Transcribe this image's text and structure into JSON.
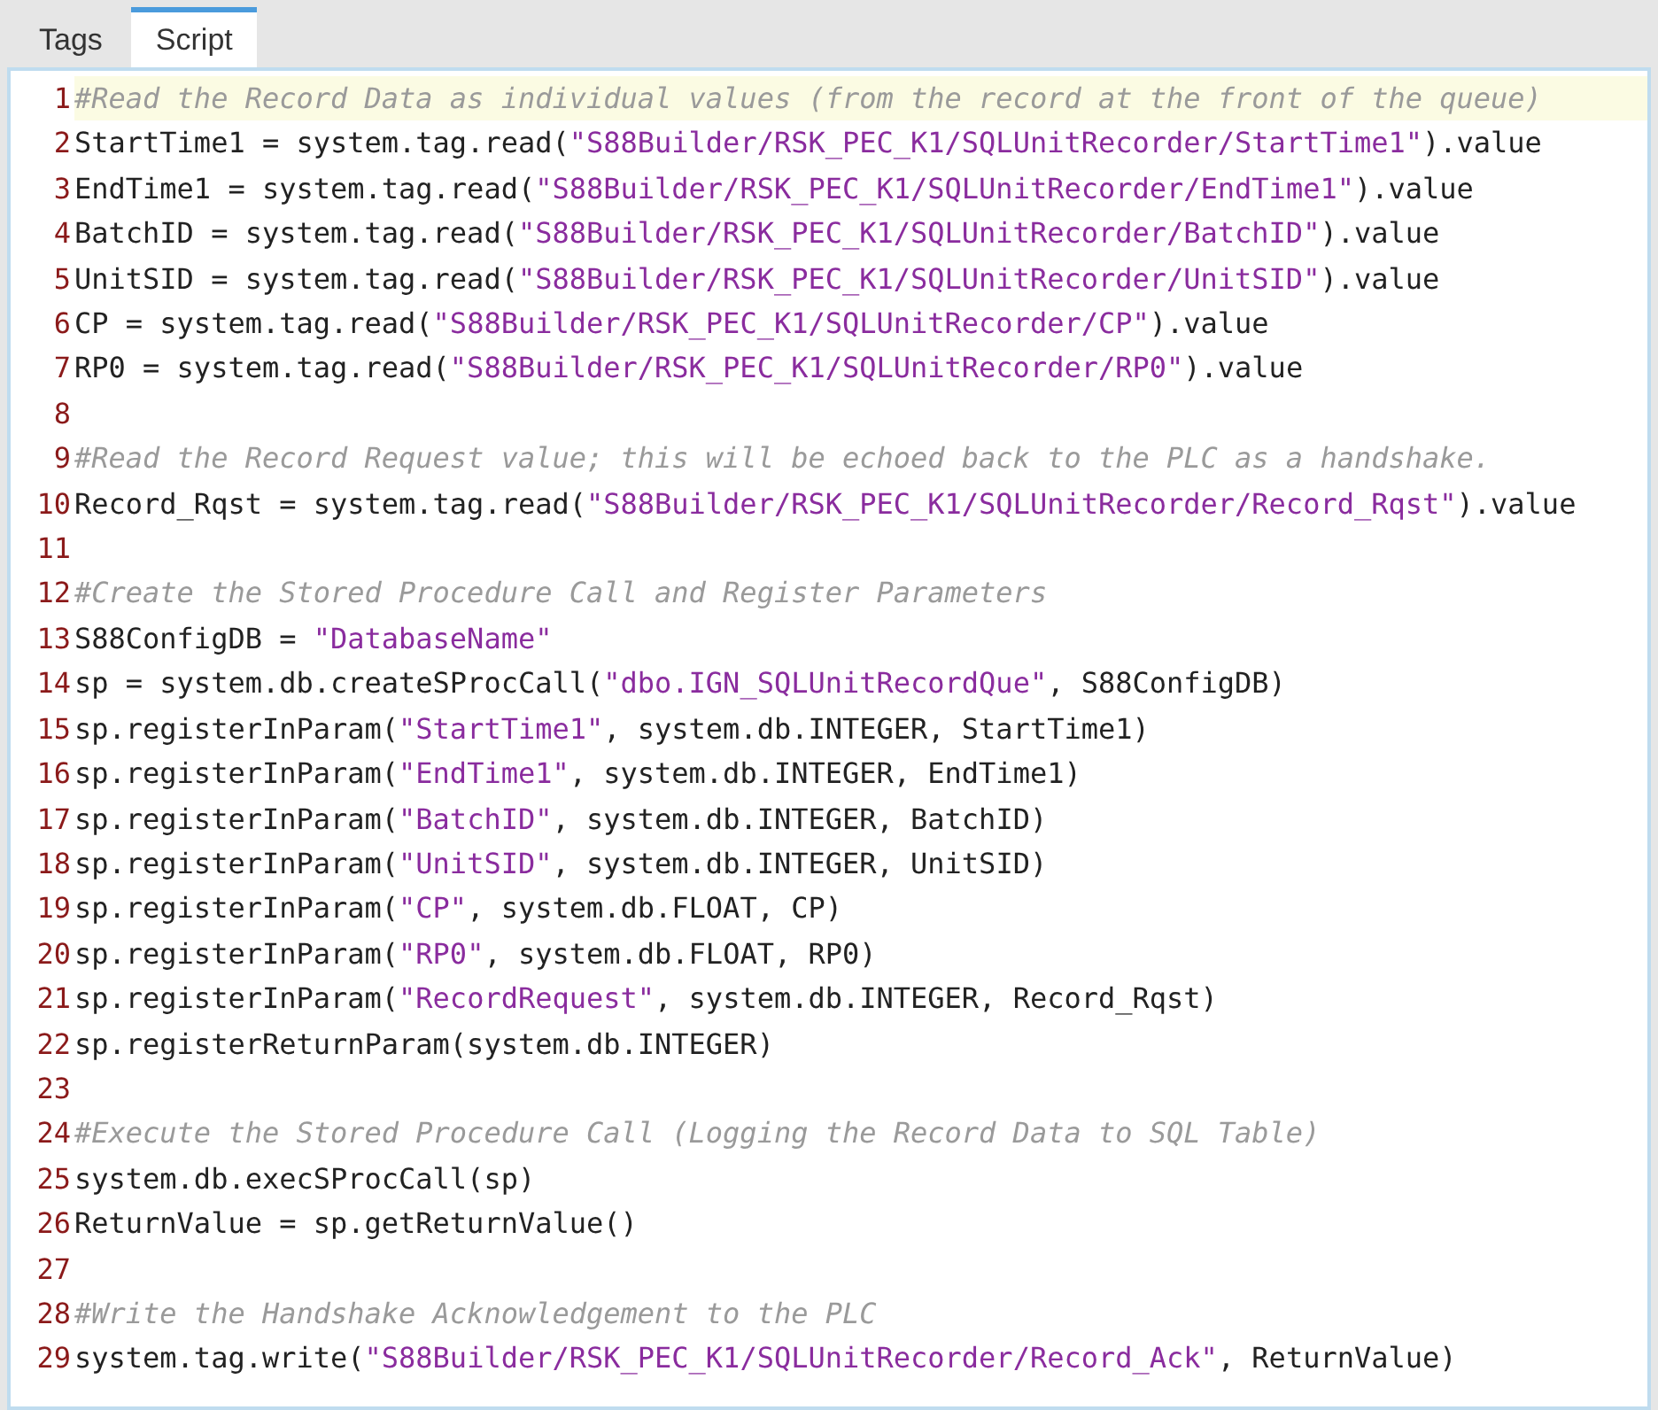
{
  "tabs": [
    {
      "label": "Tags",
      "selected": false
    },
    {
      "label": "Script",
      "selected": true
    }
  ],
  "editor": {
    "lines": [
      {
        "number": "1",
        "current": true,
        "segments": [
          {
            "kind": "comment",
            "text": "#Read the Record Data as individual values (from the record at the front of the queue)"
          }
        ]
      },
      {
        "number": "2",
        "current": false,
        "segments": [
          {
            "kind": "code",
            "text": "StartTime1 = system.tag.read("
          },
          {
            "kind": "string",
            "text": "\"S88Builder/RSK_PEC_K1/SQLUnitRecorder/StartTime1\""
          },
          {
            "kind": "code",
            "text": ").value"
          }
        ]
      },
      {
        "number": "3",
        "current": false,
        "segments": [
          {
            "kind": "code",
            "text": "EndTime1 = system.tag.read("
          },
          {
            "kind": "string",
            "text": "\"S88Builder/RSK_PEC_K1/SQLUnitRecorder/EndTime1\""
          },
          {
            "kind": "code",
            "text": ").value"
          }
        ]
      },
      {
        "number": "4",
        "current": false,
        "segments": [
          {
            "kind": "code",
            "text": "BatchID = system.tag.read("
          },
          {
            "kind": "string",
            "text": "\"S88Builder/RSK_PEC_K1/SQLUnitRecorder/BatchID\""
          },
          {
            "kind": "code",
            "text": ").value"
          }
        ]
      },
      {
        "number": "5",
        "current": false,
        "segments": [
          {
            "kind": "code",
            "text": "UnitSID = system.tag.read("
          },
          {
            "kind": "string",
            "text": "\"S88Builder/RSK_PEC_K1/SQLUnitRecorder/UnitSID\""
          },
          {
            "kind": "code",
            "text": ").value"
          }
        ]
      },
      {
        "number": "6",
        "current": false,
        "segments": [
          {
            "kind": "code",
            "text": "CP = system.tag.read("
          },
          {
            "kind": "string",
            "text": "\"S88Builder/RSK_PEC_K1/SQLUnitRecorder/CP\""
          },
          {
            "kind": "code",
            "text": ").value"
          }
        ]
      },
      {
        "number": "7",
        "current": false,
        "segments": [
          {
            "kind": "code",
            "text": "RP0 = system.tag.read("
          },
          {
            "kind": "string",
            "text": "\"S88Builder/RSK_PEC_K1/SQLUnitRecorder/RP0\""
          },
          {
            "kind": "code",
            "text": ").value"
          }
        ]
      },
      {
        "number": "8",
        "current": false
      },
      {
        "number": "9",
        "current": false,
        "segments": [
          {
            "kind": "comment",
            "text": "#Read the Record Request value; this will be echoed back to the PLC as a handshake."
          }
        ]
      },
      {
        "number": "10",
        "current": false,
        "segments": [
          {
            "kind": "code",
            "text": "Record_Rqst = system.tag.read("
          },
          {
            "kind": "string",
            "text": "\"S88Builder/RSK_PEC_K1/SQLUnitRecorder/Record_Rqst\""
          },
          {
            "kind": "code",
            "text": ").value"
          }
        ]
      },
      {
        "number": "11",
        "current": false
      },
      {
        "number": "12",
        "current": false,
        "segments": [
          {
            "kind": "comment",
            "text": "#Create the Stored Procedure Call and Register Parameters"
          }
        ]
      },
      {
        "number": "13",
        "current": false,
        "segments": [
          {
            "kind": "code",
            "text": "S88ConfigDB = "
          },
          {
            "kind": "string",
            "text": "\"DatabaseName\""
          }
        ]
      },
      {
        "number": "14",
        "current": false,
        "segments": [
          {
            "kind": "code",
            "text": "sp = system.db.createSProcCall("
          },
          {
            "kind": "string",
            "text": "\"dbo.IGN_SQLUnitRecordQue\""
          },
          {
            "kind": "code",
            "text": ", S88ConfigDB)"
          }
        ]
      },
      {
        "number": "15",
        "current": false,
        "segments": [
          {
            "kind": "code",
            "text": "sp.registerInParam("
          },
          {
            "kind": "string",
            "text": "\"StartTime1\""
          },
          {
            "kind": "code",
            "text": ", system.db.INTEGER, StartTime1)"
          }
        ]
      },
      {
        "number": "16",
        "current": false,
        "segments": [
          {
            "kind": "code",
            "text": "sp.registerInParam("
          },
          {
            "kind": "string",
            "text": "\"EndTime1\""
          },
          {
            "kind": "code",
            "text": ", system.db.INTEGER, EndTime1)"
          }
        ]
      },
      {
        "number": "17",
        "current": false,
        "segments": [
          {
            "kind": "code",
            "text": "sp.registerInParam("
          },
          {
            "kind": "string",
            "text": "\"BatchID\""
          },
          {
            "kind": "code",
            "text": ", system.db.INTEGER, BatchID)"
          }
        ]
      },
      {
        "number": "18",
        "current": false,
        "segments": [
          {
            "kind": "code",
            "text": "sp.registerInParam("
          },
          {
            "kind": "string",
            "text": "\"UnitSID\""
          },
          {
            "kind": "code",
            "text": ", system.db.INTEGER, UnitSID)"
          }
        ]
      },
      {
        "number": "19",
        "current": false,
        "segments": [
          {
            "kind": "code",
            "text": "sp.registerInParam("
          },
          {
            "kind": "string",
            "text": "\"CP\""
          },
          {
            "kind": "code",
            "text": ", system.db.FLOAT, CP)"
          }
        ]
      },
      {
        "number": "20",
        "current": false,
        "segments": [
          {
            "kind": "code",
            "text": "sp.registerInParam("
          },
          {
            "kind": "string",
            "text": "\"RP0\""
          },
          {
            "kind": "code",
            "text": ", system.db.FLOAT, RP0)"
          }
        ]
      },
      {
        "number": "21",
        "current": false,
        "segments": [
          {
            "kind": "code",
            "text": "sp.registerInParam("
          },
          {
            "kind": "string",
            "text": "\"RecordRequest\""
          },
          {
            "kind": "code",
            "text": ", system.db.INTEGER, Record_Rqst)"
          }
        ]
      },
      {
        "number": "22",
        "current": false,
        "segments": [
          {
            "kind": "code",
            "text": "sp.registerReturnParam(system.db.INTEGER)"
          }
        ]
      },
      {
        "number": "23",
        "current": false
      },
      {
        "number": "24",
        "current": false,
        "segments": [
          {
            "kind": "comment",
            "text": "#Execute the Stored Procedure Call (Logging the Record Data to SQL Table)"
          }
        ]
      },
      {
        "number": "25",
        "current": false,
        "segments": [
          {
            "kind": "code",
            "text": "system.db.execSProcCall(sp)"
          }
        ]
      },
      {
        "number": "26",
        "current": false,
        "segments": [
          {
            "kind": "code",
            "text": "ReturnValue = sp.getReturnValue()"
          }
        ]
      },
      {
        "number": "27",
        "current": false
      },
      {
        "number": "28",
        "current": false,
        "segments": [
          {
            "kind": "comment",
            "text": "#Write the Handshake Acknowledgement to the PLC"
          }
        ]
      },
      {
        "number": "29",
        "current": false,
        "segments": [
          {
            "kind": "code",
            "text": "system.tag.write("
          },
          {
            "kind": "string",
            "text": "\"S88Builder/RSK_PEC_K1/SQLUnitRecorder/Record_Ack\""
          },
          {
            "kind": "code",
            "text": ", ReturnValue)"
          }
        ]
      }
    ]
  }
}
